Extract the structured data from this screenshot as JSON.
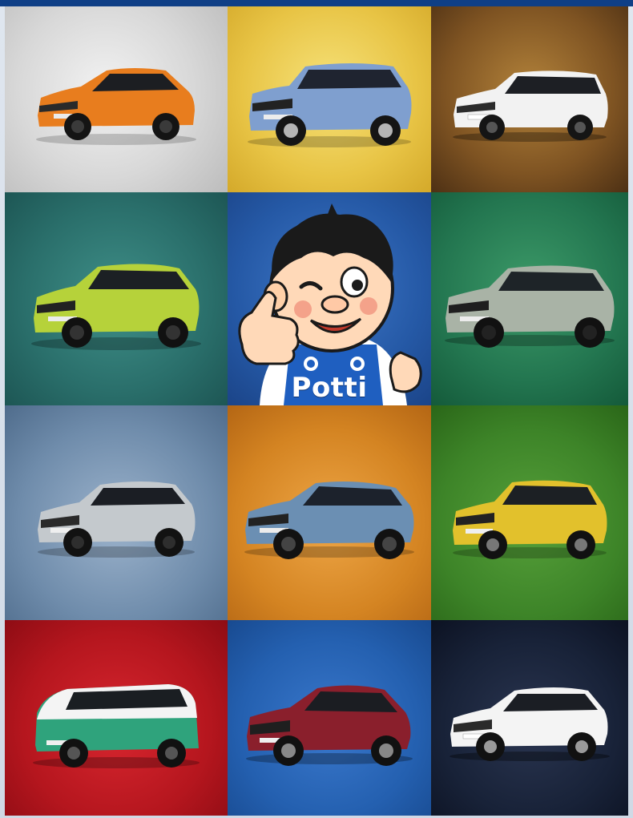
{
  "colors": {
    "frame_top": "#0f3f86",
    "mascot_overalls": "#1f5fc0",
    "mascot_skin": "#ffd9b8"
  },
  "mascot": {
    "name_label": "Potti",
    "icon": "thumbs-up-mascot-icon"
  },
  "tiles": [
    {
      "id": "car-1",
      "body_color": "#e87d1e",
      "bg": "silver",
      "type": "hatchback"
    },
    {
      "id": "car-2",
      "body_color": "#7f9fcf",
      "bg": "yellow",
      "type": "suv"
    },
    {
      "id": "car-3",
      "body_color": "#f2f2f2",
      "bg": "bronze",
      "type": "wagon"
    },
    {
      "id": "car-4",
      "body_color": "#b6d23a",
      "bg": "teal",
      "type": "hatchback"
    },
    {
      "id": "mascot",
      "bg": "blue"
    },
    {
      "id": "car-5",
      "body_color": "#a9b3a6",
      "bg": "green",
      "type": "suv"
    },
    {
      "id": "car-6",
      "body_color": "#c4c9cd",
      "bg": "slate",
      "type": "hatchback"
    },
    {
      "id": "car-7",
      "body_color": "#6b8fb3",
      "bg": "orange",
      "type": "suv"
    },
    {
      "id": "car-8",
      "body_color": "#e2c12c",
      "bg": "grass",
      "type": "suv"
    },
    {
      "id": "car-9",
      "body_color": "#2fa37c",
      "bg": "red",
      "type": "van"
    },
    {
      "id": "car-10",
      "body_color": "#8a1f2c",
      "bg": "royal",
      "type": "coupe-suv"
    },
    {
      "id": "car-11",
      "body_color": "#f4f4f4",
      "bg": "navy",
      "type": "hatchback"
    }
  ]
}
